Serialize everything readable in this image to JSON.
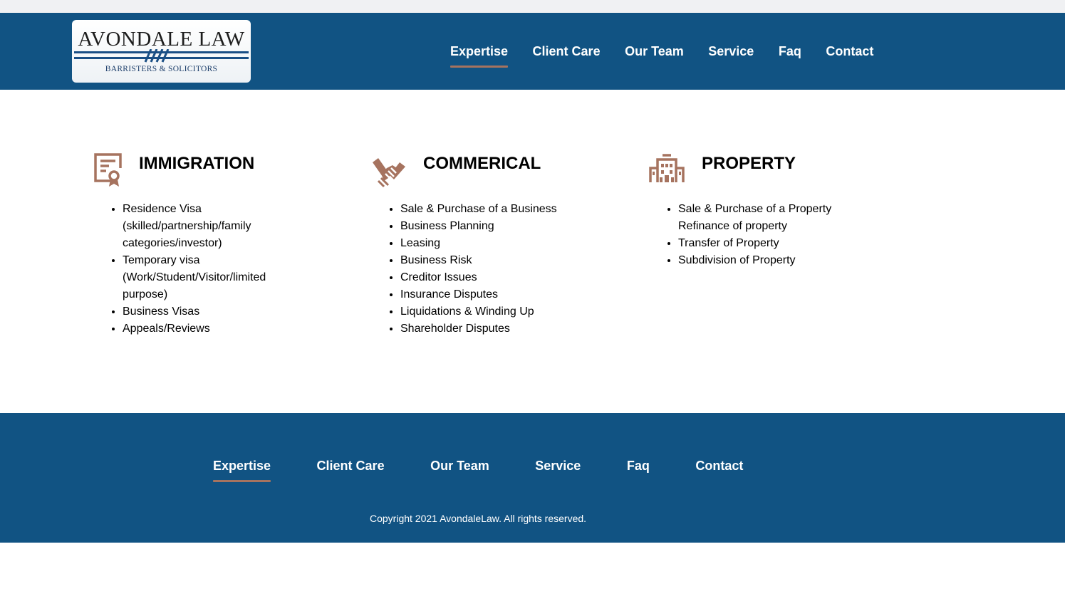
{
  "brand": {
    "name": "AVONDALE LAW",
    "tagline": "BARRISTERS & SOLICITORS",
    "header_color": "#115383",
    "accent_color": "#a6735f"
  },
  "nav": [
    {
      "label": "Expertise",
      "active": true
    },
    {
      "label": "Client Care",
      "active": false
    },
    {
      "label": "Our Team",
      "active": false
    },
    {
      "label": "Service",
      "active": false
    },
    {
      "label": "Faq",
      "active": false
    },
    {
      "label": "Contact",
      "active": false
    }
  ],
  "sections": [
    {
      "title": "IMMIGRATION",
      "icon": "certificate-icon",
      "items": [
        "Residence Visa (skilled/partnership/family categories/investor)",
        "Temporary visa (Work/Student/Visitor/limited purpose)",
        "Business Visas",
        "Appeals/Reviews"
      ]
    },
    {
      "title": "COMMERICAL",
      "icon": "handshake-icon",
      "items": [
        "Sale & Purchase of a Business",
        "Business Planning",
        "Leasing",
        "Business Risk",
        "Creditor Issues",
        "Insurance Disputes",
        "Liquidations & Winding Up",
        "Shareholder Disputes"
      ]
    },
    {
      "title": "PROPERTY",
      "icon": "building-icon",
      "items": [
        "Sale & Purchase of a Property",
        "Refinance of property",
        "Transfer of Property",
        "Subdivision of Property"
      ]
    }
  ],
  "footer": {
    "copyright": "Copyright 2021 AvondaleLaw. All rights reserved."
  }
}
